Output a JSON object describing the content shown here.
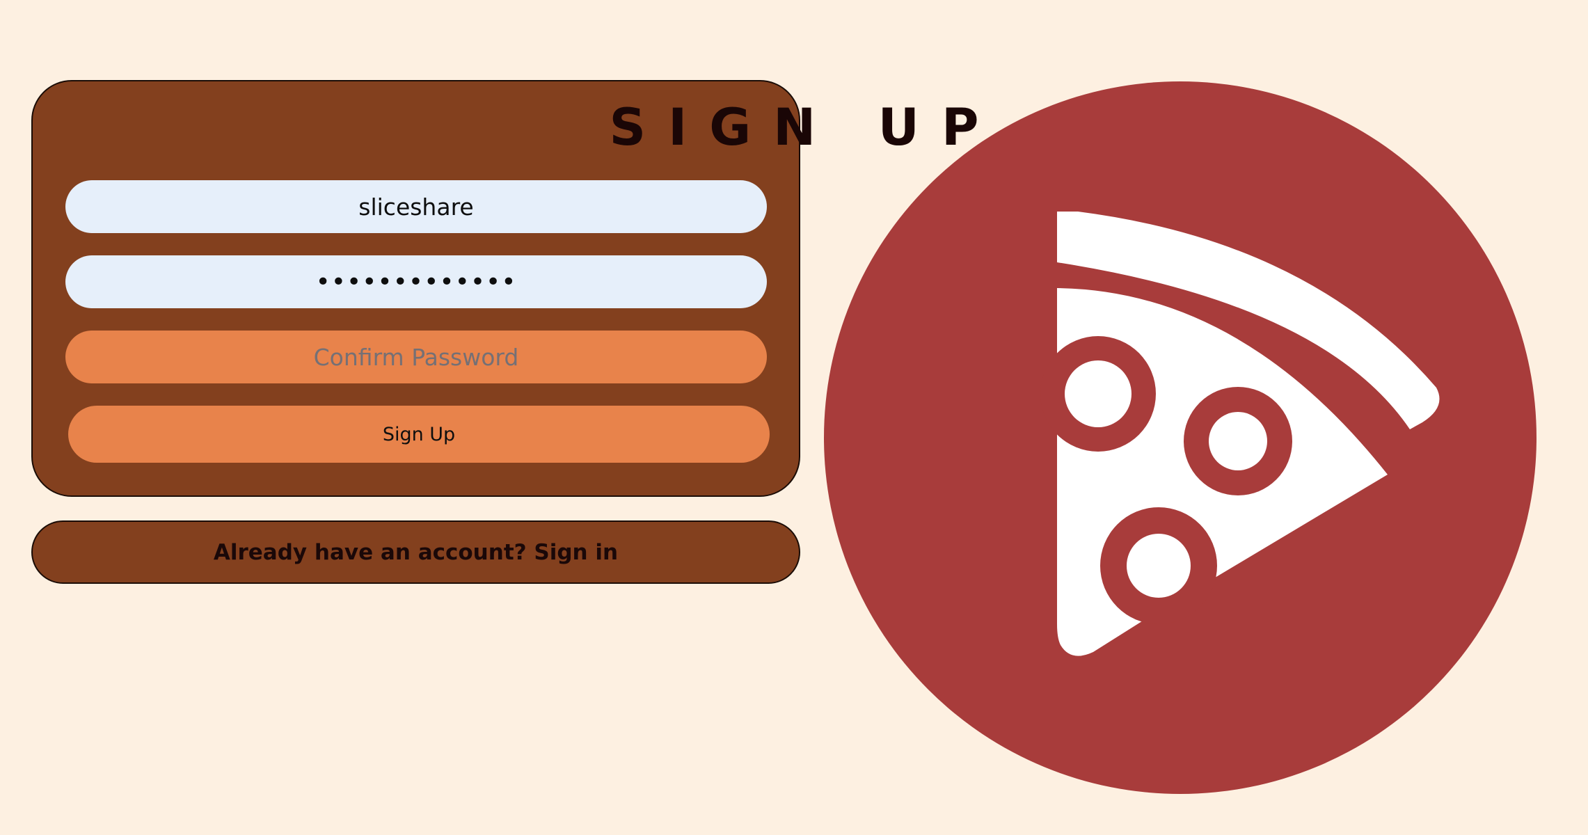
{
  "form": {
    "title": "SIGN UP",
    "username_value": "sliceshare",
    "password_value": "aaaaaaaaaaaaa",
    "confirm_placeholder": "Confirm Password",
    "submit_label": "Sign Up"
  },
  "signin_link": {
    "text": "Already have an account? Sign in"
  },
  "logo": {
    "icon": "pizza-slice-icon",
    "circle_color": "#a83c3b",
    "slice_color": "#ffffff"
  },
  "colors": {
    "background": "#fdf0e1",
    "card": "#83401e",
    "input_filled": "#e6effa",
    "accent": "#e8834b"
  }
}
